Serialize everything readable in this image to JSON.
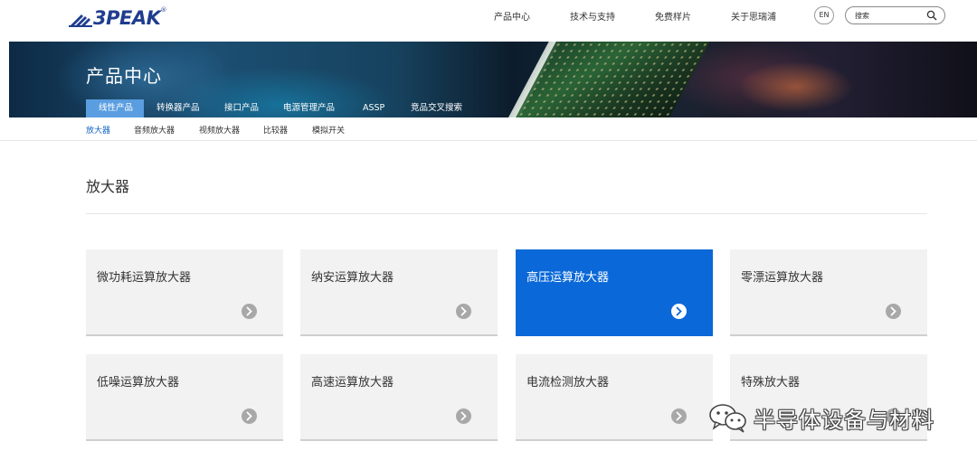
{
  "header": {
    "logo_text": "3PEAK",
    "logo_reg": "®",
    "nav": [
      "产品中心",
      "技术与支持",
      "免费样片",
      "关于思瑞浦"
    ],
    "lang_button": "EN",
    "search_placeholder": "搜索"
  },
  "banner": {
    "title": "产品中心",
    "category_tabs": [
      "线性产品",
      "转换器产品",
      "接口产品",
      "电源管理产品",
      "ASSP",
      "竞品交叉搜索"
    ],
    "active_category": "线性产品"
  },
  "subtabs": {
    "items": [
      "放大器",
      "音频放大器",
      "视频放大器",
      "比较器",
      "模拟开关"
    ],
    "active": "放大器"
  },
  "section": {
    "title": "放大器"
  },
  "products": [
    {
      "label": "微功耗运算放大器",
      "active": false
    },
    {
      "label": "纳安运算放大器",
      "active": false
    },
    {
      "label": "高压运算放大器",
      "active": true
    },
    {
      "label": "零漂运算放大器",
      "active": false
    },
    {
      "label": "低噪运算放大器",
      "active": false
    },
    {
      "label": "高速运算放大器",
      "active": false
    },
    {
      "label": "电流检测放大器",
      "active": false
    },
    {
      "label": "特殊放大器",
      "active": false
    }
  ],
  "watermark": {
    "text": "半导体设备与材料",
    "icon": "wechat-icon"
  },
  "colors": {
    "brand": "#1f3d8f",
    "accent": "#0a68d8",
    "tab_active": "#5a9de0"
  }
}
